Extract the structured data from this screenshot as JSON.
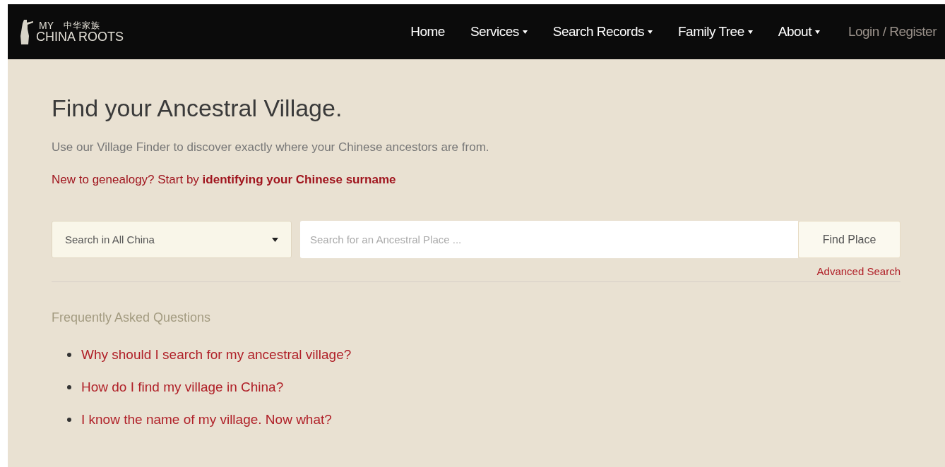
{
  "header": {
    "logo": {
      "top": "MY",
      "chinese": "中华家族",
      "bottom": "CHINA ROOTS"
    },
    "nav": [
      {
        "label": "Home",
        "kind": "plain"
      },
      {
        "label": "Services",
        "kind": "menu"
      },
      {
        "label": "Search Records",
        "kind": "menu"
      },
      {
        "label": "Family Tree",
        "kind": "menu"
      },
      {
        "label": "About",
        "kind": "menu"
      },
      {
        "label": "Login / Register",
        "kind": "account"
      }
    ]
  },
  "title": "Find your Ancestral Village.",
  "intro": "Use our Village Finder to discover exactly where your Chinese ancestors are from.",
  "prompt": {
    "text": "New to genealogy? Start by ",
    "link": "identifying your Chinese surname"
  },
  "search": {
    "region": "Search in All China",
    "placeholder": "Search for an Ancestral Place ...",
    "button": "Find Place",
    "advanced": "Advanced Search"
  },
  "faq": {
    "heading": "Frequently Asked Questions",
    "items": [
      "Why should I search for my ancestral village?",
      "How do I find my village in China?",
      "I know the name of my village. Now what?"
    ]
  }
}
